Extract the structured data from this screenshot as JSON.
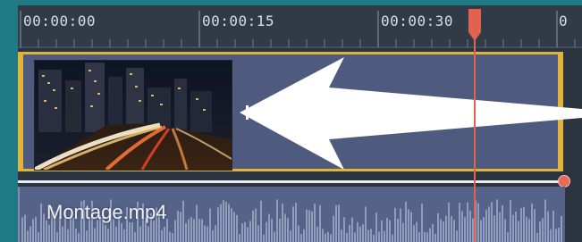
{
  "ruler": {
    "timecodes": [
      "00:00:00",
      "00:00:15",
      "00:00:30",
      "0"
    ]
  },
  "video_track": {
    "thumbnail_desc": "city-night-traffic"
  },
  "audio_track": {
    "clip_name": "Montage.mp4"
  },
  "colors": {
    "background": "#1f7a86",
    "ruler": "#313a47",
    "video_clip": "#4e5a7e",
    "selection_border": "#e0b43a",
    "audio_clip": "#566389",
    "playhead": "#e0624f"
  }
}
